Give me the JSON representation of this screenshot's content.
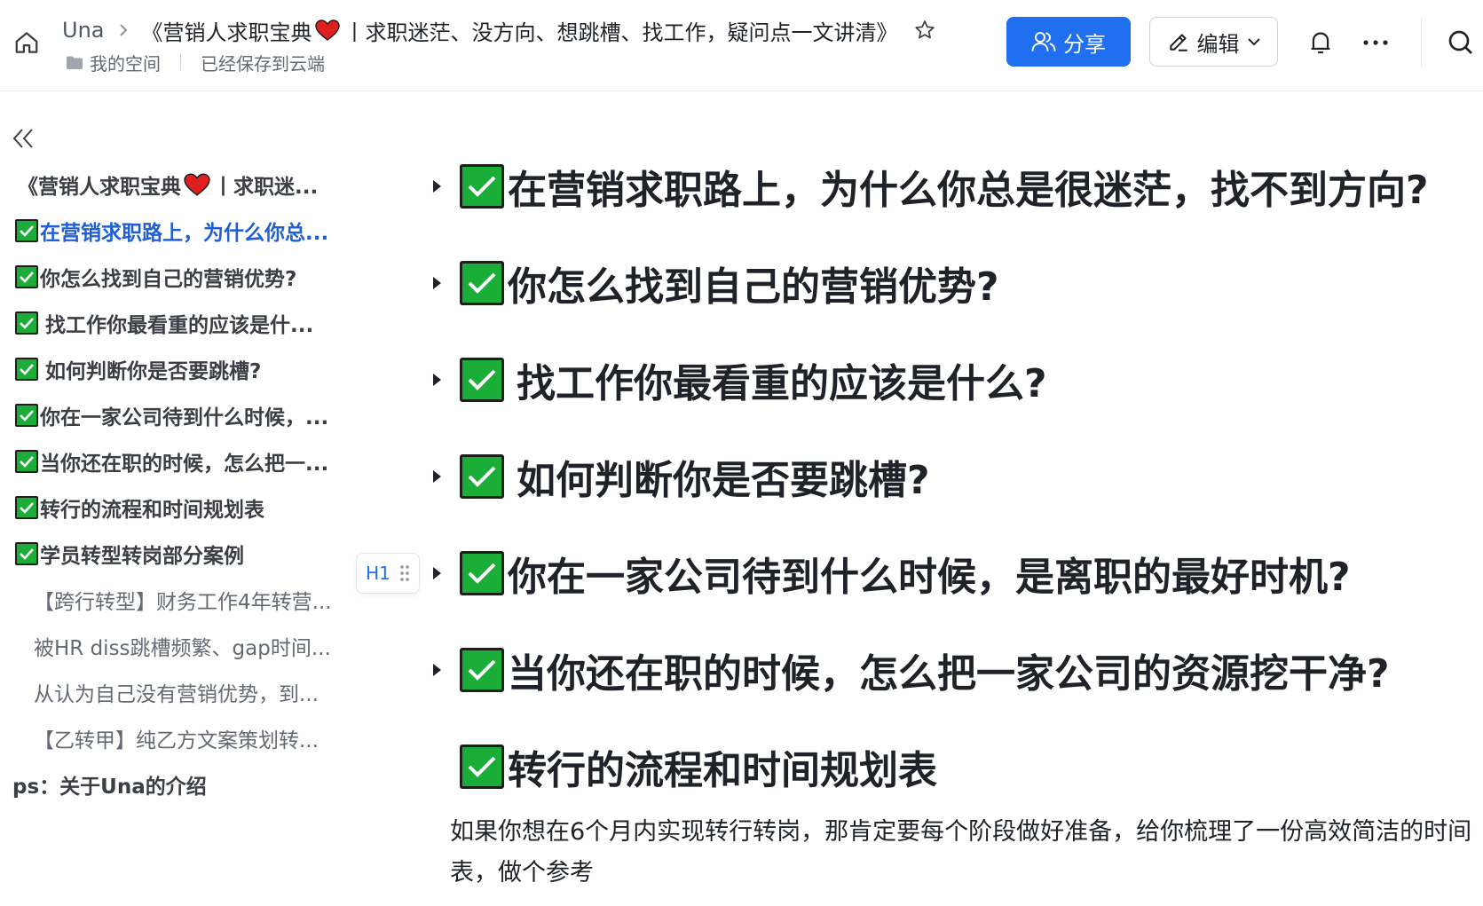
{
  "header": {
    "breadcrumb_user": "Una",
    "doc_title_part1": "《营销人求职宝典",
    "doc_title_part2": "丨求职迷茫、没方向、想跳槽、找工作，疑问点一文讲清》",
    "space_label": "我的空间",
    "save_status": "已经保存到云端",
    "share_label": "分享",
    "edit_label": "编辑",
    "accent_color": "#1f6ff0"
  },
  "outline": {
    "items": [
      {
        "label_a": "《营销人求职宝典",
        "label_b": "丨求职迷...",
        "type": "title"
      },
      {
        "label": "在营销求职路上，为什么你总...",
        "type": "active"
      },
      {
        "label": "你怎么找到自己的营销优势?",
        "type": "check"
      },
      {
        "label": " 找工作你最看重的应该是什...",
        "type": "check"
      },
      {
        "label": " 如何判断你是否要跳槽?",
        "type": "check"
      },
      {
        "label": "你在一家公司待到什么时候，...",
        "type": "check"
      },
      {
        "label": "当你还在职的时候，怎么把一...",
        "type": "check"
      },
      {
        "label": "转行的流程和时间规划表",
        "type": "check"
      },
      {
        "label": "学员转型转岗部分案例",
        "type": "check"
      },
      {
        "label": "【跨行转型】财务工作4年转营...",
        "type": "sub"
      },
      {
        "label": "被HR diss跳槽频繁、gap时间...",
        "type": "sub"
      },
      {
        "label": "从认为自己没有营销优势，到...",
        "type": "sub"
      },
      {
        "label": "【乙转甲】纯乙方文案策划转...",
        "type": "sub"
      },
      {
        "label": "ps：关于Una的介绍",
        "type": "plain"
      }
    ]
  },
  "hover_tag": {
    "label": "H1"
  },
  "document": {
    "headings": [
      "在营销求职路上，为什么你总是很迷茫，找不到方向?",
      "你怎么找到自己的营销优势?",
      " 找工作你最看重的应该是什么?",
      " 如何判断你是否要跳槽?",
      "你在一家公司待到什么时候，是离职的最好时机?",
      "当你还在职的时候，怎么把一家公司的资源挖干净?",
      "转行的流程和时间规划表"
    ],
    "paragraph": "如果你想在6个月内实现转行转岗，那肯定要每个阶段做好准备，给你梳理了一份高效简洁的时间表，做个参考"
  },
  "colors": {
    "check_green": "#1aae39",
    "active_outline": "#1f5fd6"
  },
  "icons": [
    "home-icon",
    "chevron-right-icon",
    "heart-icon",
    "star-icon",
    "folder-icon",
    "users-icon",
    "pencil-icon",
    "chevron-down-icon",
    "bell-icon",
    "more-icon",
    "search-icon",
    "double-chevron-left-icon",
    "checkbox-icon",
    "drag-handle-icon",
    "caret-right-icon"
  ]
}
